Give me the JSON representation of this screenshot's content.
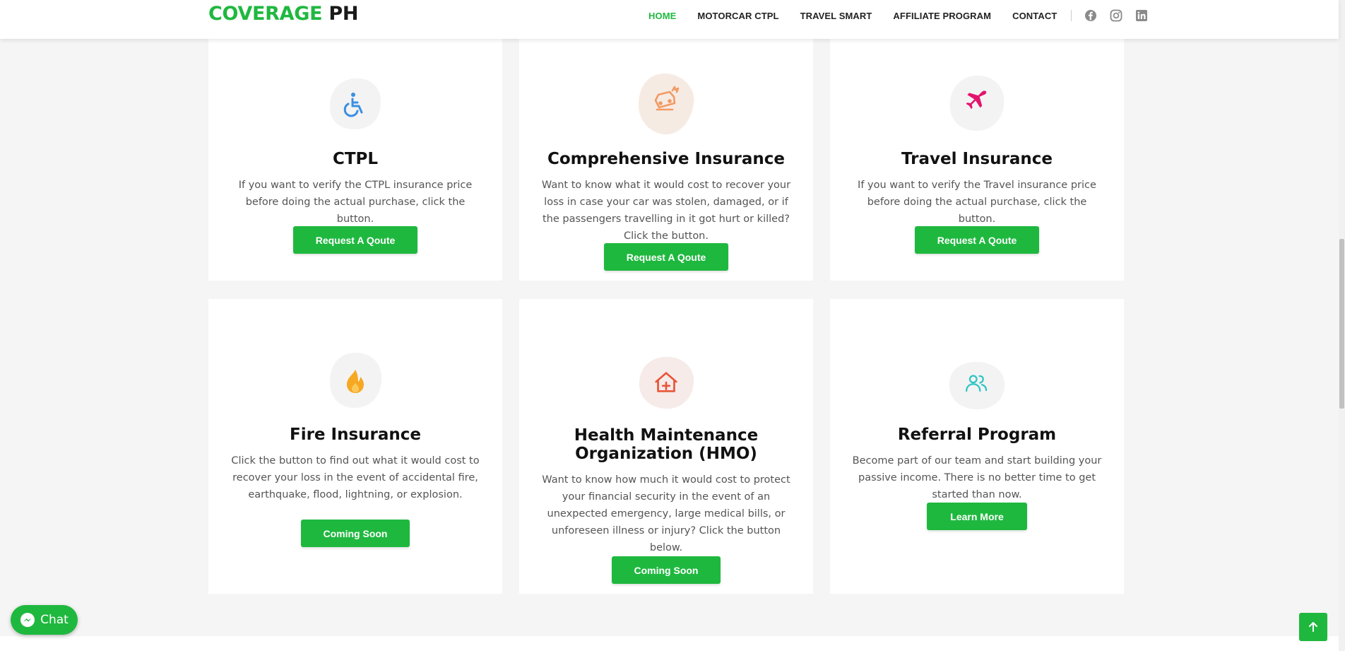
{
  "header": {
    "logo_part1": "COVERAGE",
    "logo_part2": "PH",
    "nav": [
      "HOME",
      "MOTORCAR CTPL",
      "TRAVEL SMART",
      "AFFILIATE PROGRAM",
      "CONTACT"
    ],
    "active_nav": "HOME",
    "social_icons": [
      "facebook-icon",
      "instagram-icon",
      "linkedin-icon"
    ]
  },
  "cards": [
    {
      "title": "CTPL",
      "icon": "wheelchair-icon",
      "icon_color": "#3b8fe0",
      "description": "If you want to verify the CTPL insurance price before doing the actual purchase, click the button.",
      "button": "Request A Qoute"
    },
    {
      "title": "Comprehensive Insurance",
      "icon": "car-crash-icon",
      "icon_color": "#f29a64",
      "description": "Want to know what it would cost to recover your loss in case your car was stolen, damaged, or if the passengers travelling in it got hurt or killed? Click the button.",
      "button": "Request A Qoute"
    },
    {
      "title": "Travel Insurance",
      "icon": "airplane-icon",
      "icon_color": "#e3146d",
      "description": "If you want to verify the Travel insurance price before doing the actual purchase, click the button.",
      "button": "Request A Qoute"
    },
    {
      "title": "Fire Insurance",
      "icon": "fire-icon",
      "icon_color": "#f7a823",
      "description": "Click the button to find out what it would cost to recover your loss in the event of accidental fire, earthquake, flood, lightning, or explosion.",
      "button": "Coming Soon"
    },
    {
      "title_line1": "Health Maintenance",
      "title_line2": "Organization (HMO)",
      "icon": "house-medical-icon",
      "icon_color": "#e8553a",
      "description": "Want to know how much it would cost to protect your financial security in the event of an unexpected emergency, large medical bills, or unforeseen illness or injury? Click the button below.",
      "button": "Coming Soon"
    },
    {
      "title": "Referral Program",
      "icon": "users-icon",
      "icon_color": "#2ec4c4",
      "description": "Become part of our team and start building your passive income. There is no better time to get started than now.",
      "button": "Learn More"
    }
  ],
  "chat": {
    "label": "Chat",
    "icon": "messenger-icon"
  },
  "back_to_top": {
    "icon": "arrow-up-icon"
  },
  "colors": {
    "brand": "#1fb83f",
    "text": "#111111",
    "body_text": "#555555"
  }
}
